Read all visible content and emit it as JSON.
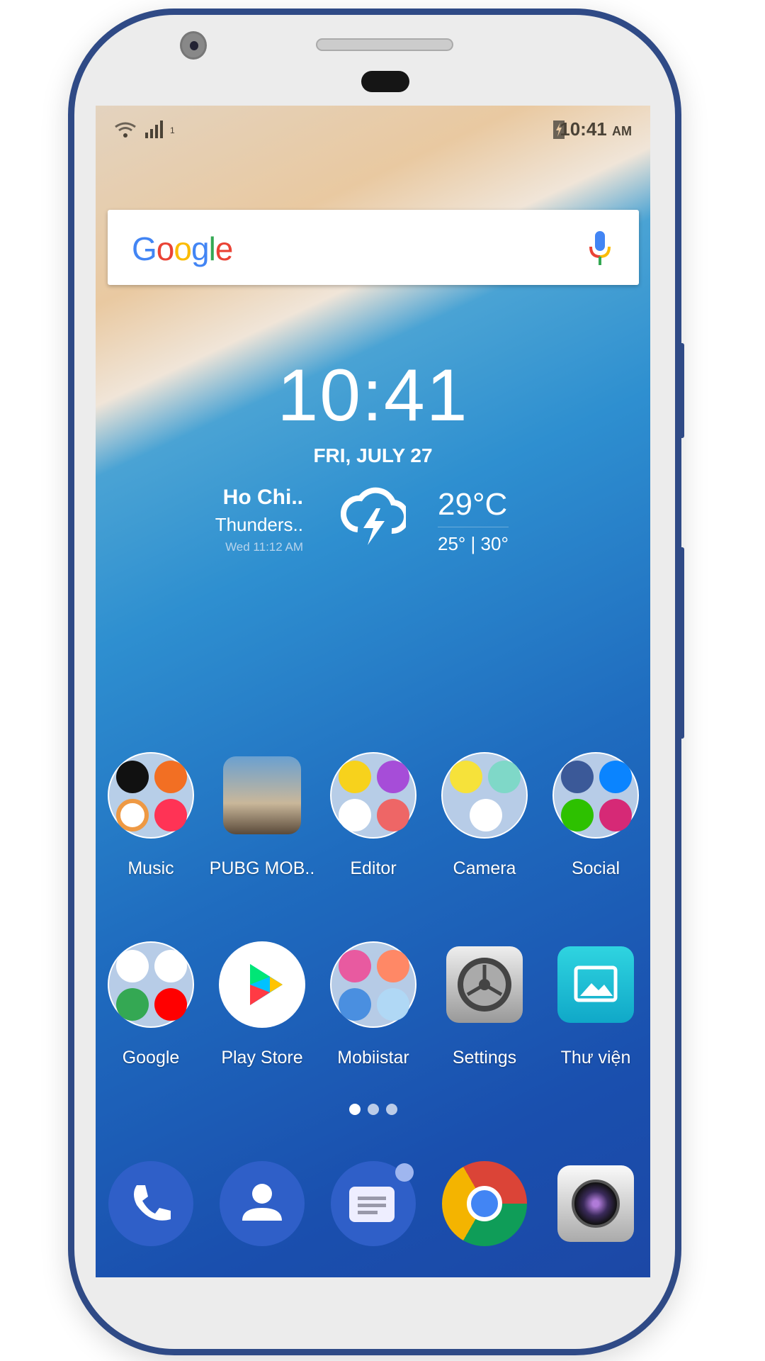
{
  "status_bar": {
    "time": "10:41",
    "ampm": "AM",
    "sim": "1",
    "icons": [
      "wifi-icon",
      "signal-icon",
      "battery-charging-icon"
    ]
  },
  "search": {
    "logo": "Google",
    "icon": "mic-icon"
  },
  "clock": {
    "time": "10:41",
    "date": "FRI, JULY 27"
  },
  "weather": {
    "city": "Ho Chi..",
    "condition": "Thunders..",
    "updated": "Wed 11:12 AM",
    "temp": "29°C",
    "range": "25° | 30°",
    "icon": "thunderstorm-icon"
  },
  "apps_row1": [
    {
      "label": "Music"
    },
    {
      "label": "PUBG MOB.."
    },
    {
      "label": "Editor"
    },
    {
      "label": "Camera"
    },
    {
      "label": "Social"
    }
  ],
  "apps_row2": [
    {
      "label": "Google"
    },
    {
      "label": "Play Store"
    },
    {
      "label": "Mobiistar"
    },
    {
      "label": "Settings"
    },
    {
      "label": "Thư viện"
    }
  ],
  "pages": {
    "count": 3,
    "current": 1
  },
  "dock": [
    "phone-icon",
    "contacts-icon",
    "messages-icon",
    "chrome-icon",
    "camera-icon"
  ]
}
